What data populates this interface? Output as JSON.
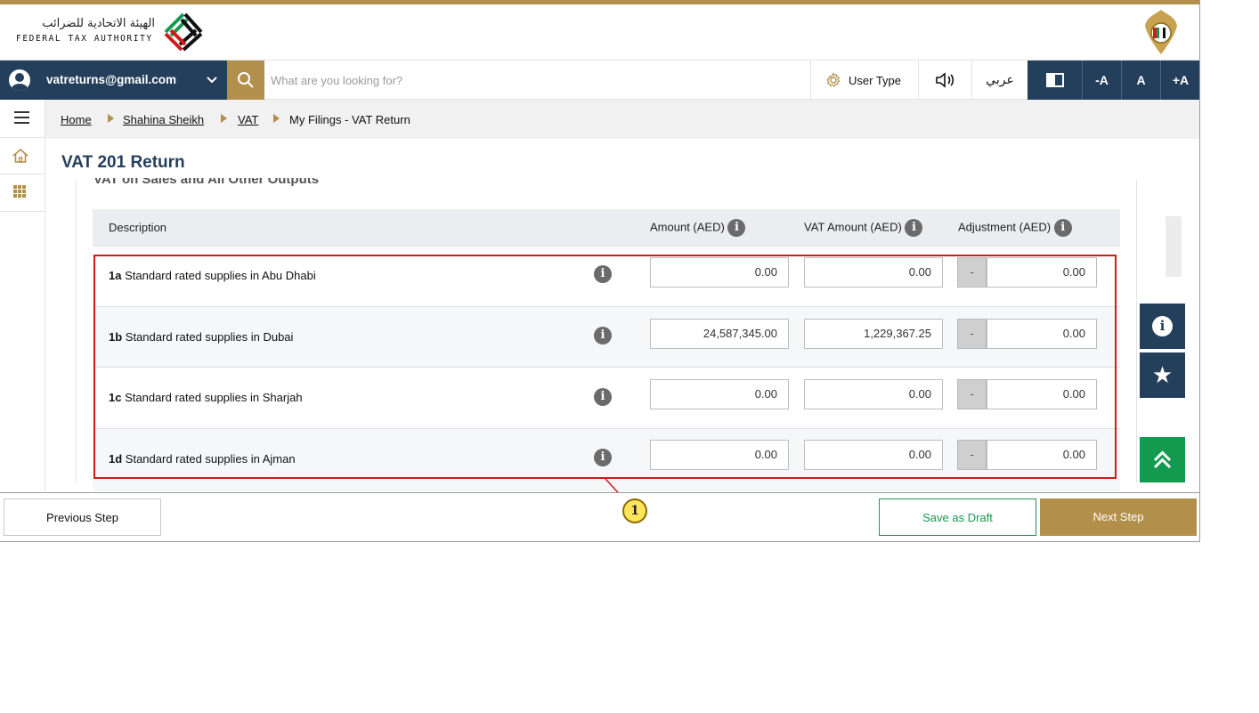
{
  "header": {
    "org_name_ar": "الهيئة الاتحادية للضرائب",
    "org_name_en": "FEDERAL TAX AUTHORITY",
    "logo_icon": "fta-logo-icon",
    "emblem_icon": "uae-emblem-icon"
  },
  "navbar": {
    "account_email": "vatreturns@gmail.com",
    "search_placeholder": "What are you looking for?",
    "user_type_label": "User Type",
    "language_label": "عربي",
    "font_decrease": "-A",
    "font_normal": "A",
    "font_increase": "+A"
  },
  "breadcrumb": [
    "Home",
    "Shahina Sheikh",
    "VAT",
    "My Filings - VAT Return"
  ],
  "page": {
    "title": "VAT 201 Return",
    "section_heading_partial": "VAT on Sales and All Other Outputs"
  },
  "table": {
    "headers": {
      "description": "Description",
      "amount": "Amount (AED)",
      "vat_amount": "VAT Amount (AED)",
      "adjustment": "Adjustment (AED)"
    },
    "rows": [
      {
        "code": "1a",
        "label": "Standard rated supplies in Abu Dhabi",
        "amount": "0.00",
        "vat_amount": "0.00",
        "adj_sign": "-",
        "adjustment": "0.00"
      },
      {
        "code": "1b",
        "label": "Standard rated supplies in Dubai",
        "amount": "24,587,345.00",
        "vat_amount": "1,229,367.25",
        "adj_sign": "-",
        "adjustment": "0.00"
      },
      {
        "code": "1c",
        "label": "Standard rated supplies in Sharjah",
        "amount": "0.00",
        "vat_amount": "0.00",
        "adj_sign": "-",
        "adjustment": "0.00"
      },
      {
        "code": "1d",
        "label": "Standard rated supplies in Ajman",
        "amount": "0.00",
        "vat_amount": "0.00",
        "adj_sign": "-",
        "adjustment": "0.00"
      }
    ]
  },
  "annotation": {
    "badge": "1"
  },
  "footer": {
    "previous": "Previous Step",
    "save_draft": "Save as Draft",
    "next": "Next Step"
  },
  "colors": {
    "navy": "#243f5c",
    "gold": "#b38f4c",
    "green": "#149a4f",
    "highlight_red": "#d11a1a"
  }
}
